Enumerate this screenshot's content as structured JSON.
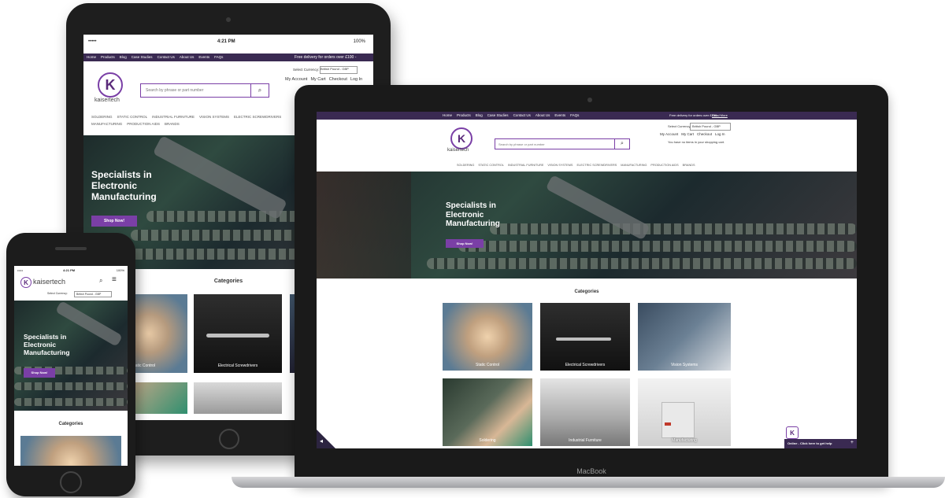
{
  "status_bar": {
    "time": "4:21 PM",
    "battery": "100%",
    "signal": "•••••"
  },
  "topnav": {
    "items": [
      "Home",
      "Products",
      "Blog",
      "Case Studies",
      "Contact Us",
      "About Us",
      "Events",
      "FAQs"
    ]
  },
  "delivery": {
    "text": "Free delivery for orders over £100 -",
    "link": "Read More"
  },
  "currency": {
    "label": "Select Currency:",
    "value": "British Pound - GBP"
  },
  "account_links": [
    "My Account",
    "My Cart",
    "Checkout",
    "Log In"
  ],
  "cart_message": "You have no items in your shopping cart.",
  "logo": {
    "letter": "K",
    "name": "kaisertech"
  },
  "search": {
    "placeholder": "Search by phrase or part number"
  },
  "categories_nav": [
    "SOLDERING",
    "STATIC CONTROL",
    "INDUSTRIAL FURNITURE",
    "VISION SYSTEMS",
    "ELECTRIC SCREWDRIVERS",
    "MANUFACTURING",
    "PRODUCTION AIDS",
    "BRANDS"
  ],
  "hero": {
    "heading_line1": "Specialists in",
    "heading_line2": "Electronic",
    "heading_line3": "Manufacturing",
    "button": "Shop Now!"
  },
  "categories": {
    "title": "Categories",
    "items": [
      {
        "label": "Static Control"
      },
      {
        "label": "Electrical Screwdrivers"
      },
      {
        "label": "Vision Systems"
      },
      {
        "label": "Soldering"
      },
      {
        "label": "Industrial Furniture"
      },
      {
        "label": "Manufacturing"
      }
    ]
  },
  "chat": {
    "text": "Online - Click here to get help",
    "plus": "+"
  },
  "laptop": {
    "brand": "MacBook"
  },
  "colors": {
    "brand_purple": "#7a3fa6",
    "nav_bar": "#3a2a52"
  }
}
